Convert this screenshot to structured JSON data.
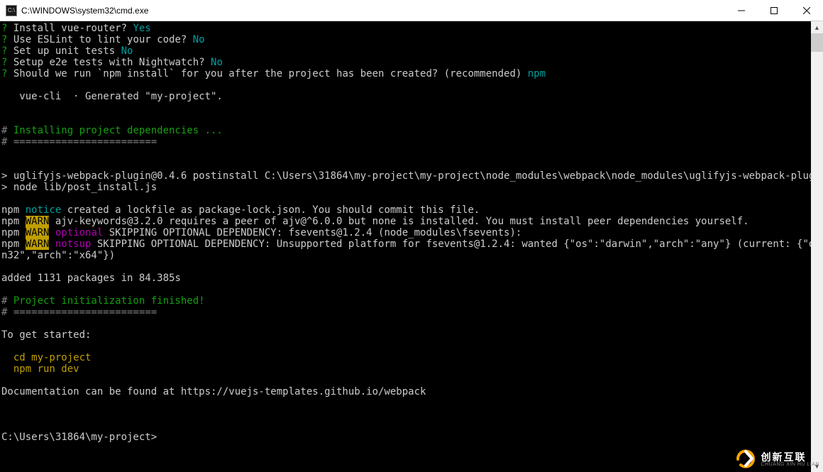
{
  "titlebar": {
    "icon_label": "C:\\",
    "title": "C:\\WINDOWS\\system32\\cmd.exe"
  },
  "term": {
    "q1": {
      "p": "?",
      "t": " Install vue-router? ",
      "a": "Yes"
    },
    "q2": {
      "p": "?",
      "t": " Use ESLint to lint your code? ",
      "a": "No"
    },
    "q3": {
      "p": "?",
      "t": " Set up unit tests ",
      "a": "No"
    },
    "q4": {
      "p": "?",
      "t": " Setup e2e tests with Nightwatch? ",
      "a": "No"
    },
    "q5": {
      "p": "?",
      "t": " Should we run `npm install` for you after the project has been created? (recommended) ",
      "a": "npm"
    },
    "generated": "   vue-cli  · Generated \"my-project\".",
    "installHeader": {
      "hash": "# ",
      "text": "Installing project dependencies ..."
    },
    "sep1": "# ========================",
    "postinstall1": "> uglifyjs-webpack-plugin@0.4.6 postinstall C:\\Users\\31864\\my-project\\my-project\\node_modules\\webpack\\node_modules\\uglifyjs-webpack-plugin",
    "postinstall2": "> node lib/post_install.js",
    "npm_notice": {
      "pre": "npm ",
      "tag": "notice",
      "post": " created a lockfile as package-lock.json. You should commit this file."
    },
    "npm_warn1": {
      "pre": "npm ",
      "tag": "WARN",
      "post": " ajv-keywords@3.2.0 requires a peer of ajv@^6.0.0 but none is installed. You must install peer dependencies yourself."
    },
    "npm_warn2": {
      "pre": "npm ",
      "tag": "WARN",
      "sub": " optional",
      "post": " SKIPPING OPTIONAL DEPENDENCY: fsevents@1.2.4 (node_modules\\fsevents):"
    },
    "npm_warn3a": {
      "pre": "npm ",
      "tag": "WARN",
      "sub": " notsup",
      "post": " SKIPPING OPTIONAL DEPENDENCY: Unsupported platform for fsevents@1.2.4: wanted {\"os\":\"darwin\",\"arch\":\"any\"} (current: {\"os\":\"wi"
    },
    "npm_warn3b": "n32\",\"arch\":\"x64\"})",
    "added": "added 1131 packages in 84.385s",
    "finished": {
      "hash": "# ",
      "text": "Project initialization finished!"
    },
    "sep2": "# ========================",
    "toget": "To get started:",
    "cmd1": "  cd my-project",
    "cmd2": "  npm run dev",
    "docs": "Documentation can be found at https://vuejs-templates.github.io/webpack",
    "prompt": "C:\\Users\\31864\\my-project>"
  },
  "watermark": {
    "cn": "创新互联",
    "en": "CHUANG XIN HU LIAN"
  }
}
